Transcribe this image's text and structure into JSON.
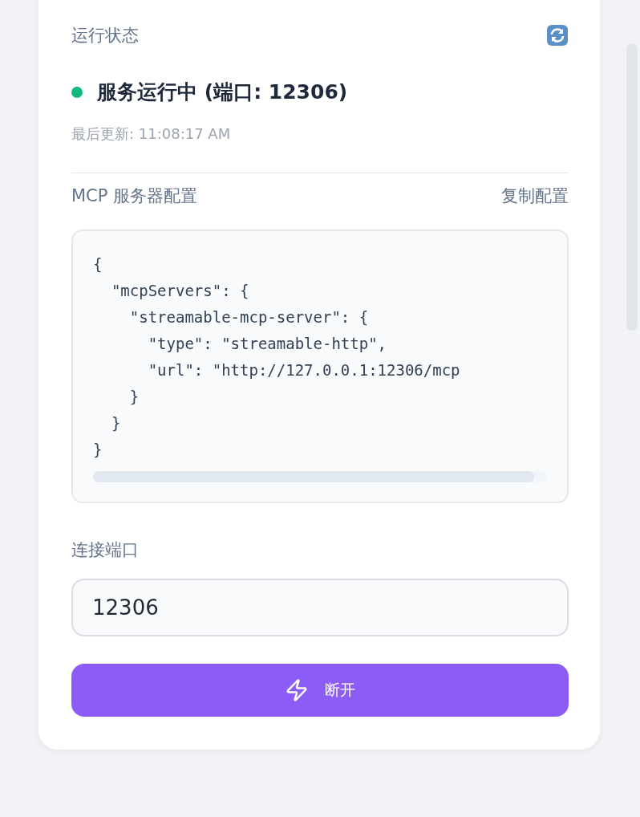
{
  "status_section": {
    "title": "运行状态",
    "running": true,
    "status_text": "服务运行中 (端口: 12306)",
    "last_updated": "最后更新: 11:08:17 AM"
  },
  "config_section": {
    "title": "MCP 服务器配置",
    "copy_link": "复制配置",
    "code_lines": [
      "{",
      "  \"mcpServers\": {",
      "    \"streamable-mcp-server\": {",
      "      \"type\": \"streamable-http\",",
      "      \"url\": \"http://127.0.0.1:12306/mcp",
      "    }",
      "  }",
      "}"
    ]
  },
  "port_field": {
    "label": "连接端口",
    "value": "12306"
  },
  "disconnect_button": {
    "label": "断开"
  }
}
